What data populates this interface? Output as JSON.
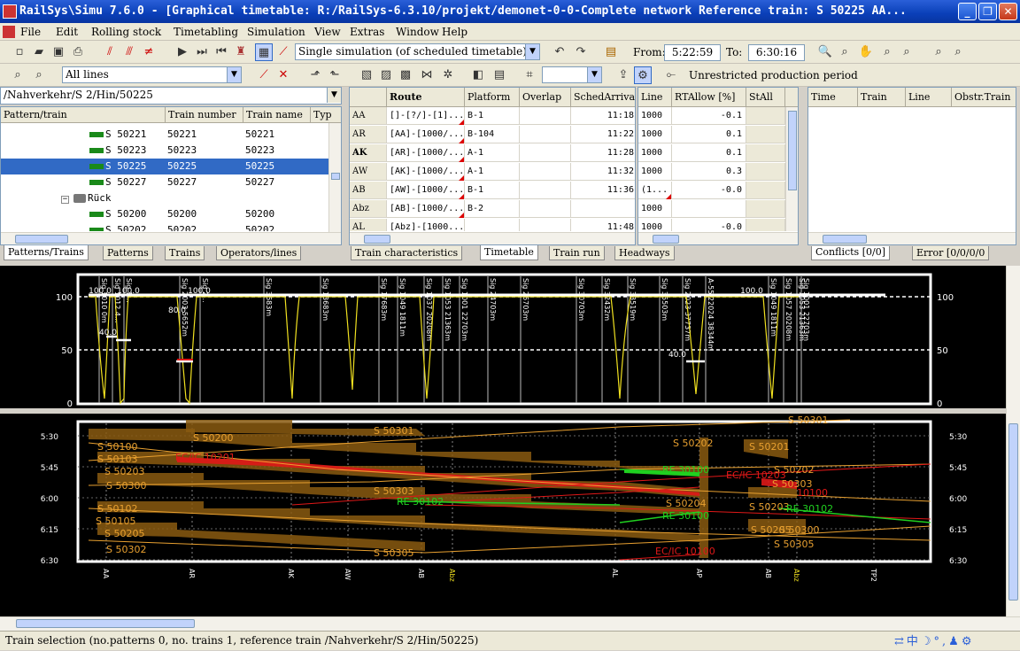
{
  "window": {
    "title": "RailSys\\Simu 7.6.0 - [Graphical timetable: R:/RailSys-6.3.10/projekt/demonet-0-0-Complete network    Reference train: S 50225    AA..."
  },
  "menu": [
    "File",
    "Edit",
    "Rolling stock",
    "Timetabling",
    "Simulation",
    "View",
    "Extras",
    "Window",
    "Help"
  ],
  "toolbar": {
    "simulation_mode": "Single simulation (of scheduled timetable)",
    "from_label": "From:",
    "from_value": "5:22:59",
    "to_label": "To:",
    "to_value": "6:30:16",
    "lines_filter": "All lines",
    "period_label": "Unrestricted production period"
  },
  "left_panel": {
    "path": "/Nahverkehr/S 2/Hin/50225",
    "columns": [
      "Pattern/train",
      "Train number",
      "Train name",
      "Typ"
    ],
    "rows": [
      {
        "name": "S 50221",
        "number": "50221",
        "tname": "50221"
      },
      {
        "name": "S 50223",
        "number": "50223",
        "tname": "50223"
      },
      {
        "name": "S 50225",
        "number": "50225",
        "tname": "50225",
        "selected": true
      },
      {
        "name": "S 50227",
        "number": "50227",
        "tname": "50227"
      },
      {
        "name": "Rück",
        "group": true
      },
      {
        "name": "S 50200",
        "number": "50200",
        "tname": "50200"
      },
      {
        "name": "S 50202",
        "number": "50202",
        "tname": "50202"
      }
    ],
    "tabs": [
      "Patterns/Trains",
      "Patterns",
      "Trains",
      "Operators/lines"
    ]
  },
  "middle_panel": {
    "columns": [
      "Route",
      "Platform",
      "Overlap",
      "SchedArrival"
    ],
    "rows": [
      {
        "stop": "AA",
        "route": "[]-[?/]-[1]...",
        "platform": "B-1",
        "overlap": "",
        "arrival": "11:18"
      },
      {
        "stop": "AR",
        "route": "[AA]-[1000/...",
        "platform": "B-104",
        "overlap": "",
        "arrival": "11:22"
      },
      {
        "stop": "AK",
        "route": "[AR]-[1000/...",
        "platform": "A-1",
        "overlap": "",
        "arrival": "11:28",
        "bold": true
      },
      {
        "stop": "AW",
        "route": "[AK]-[1000/...",
        "platform": "A-1",
        "overlap": "",
        "arrival": "11:32"
      },
      {
        "stop": "AB",
        "route": "[AW]-[1000/...",
        "platform": "B-1",
        "overlap": "",
        "arrival": "11:36"
      },
      {
        "stop": "Abz",
        "route": "[AB]-[1000/...",
        "platform": "B-2",
        "overlap": "",
        "arrival": ""
      },
      {
        "stop": "AL",
        "route": "[Abz]-[1000...",
        "platform": "",
        "overlap": "",
        "arrival": "11:48"
      }
    ],
    "tabs": [
      "Train characteristics",
      "Timetable",
      "Train run",
      "Headways"
    ]
  },
  "right_table": {
    "columns": [
      "Line",
      "RTAllow [%]",
      "StAll"
    ],
    "rows": [
      {
        "line": "1000",
        "rt": "-0.1"
      },
      {
        "line": "1000",
        "rt": "0.1"
      },
      {
        "line": "1000",
        "rt": "0.1"
      },
      {
        "line": "1000",
        "rt": "0.3"
      },
      {
        "line": "(1...",
        "rt": "-0.0"
      },
      {
        "line": "1000",
        "rt": ""
      },
      {
        "line": "1000",
        "rt": "-0.0"
      }
    ]
  },
  "conflicts_panel": {
    "columns": [
      "Time",
      "Train",
      "Line",
      "Obstr.Train"
    ],
    "tabs": [
      "Conflicts [0/0]",
      "Error [0/0/0/0"
    ]
  },
  "speed_profile": {
    "y_ticks": [
      "100",
      "50",
      "0"
    ],
    "speed_labels": [
      "100.0",
      "100.0",
      "100.0",
      "80.0",
      "40.0",
      "100.0",
      "40.0"
    ],
    "signals": [
      "Sig 1010 0m",
      "Sig 1012 4...",
      "Sig 1...",
      "Sig 2003 5652m",
      "Sig 2...",
      "Sig 3683m",
      "Sig 13683m",
      "Sig 17683m",
      "Sig 1049 1811m",
      "Sig 1037 20208m",
      "Sig 1053 21363m",
      "Sig 1001 22703m",
      "Sig 24703m",
      "Sig 26703m",
      "Sig 30703m",
      "Sig 32432m",
      "Sig 33519m",
      "Sig 35503m",
      "Sig 2023 37737m",
      "A-55 22024 38344m",
      "Sig 1049 1811m",
      "Sig 1057 20208m",
      "Sig 1053 21363m",
      "Sig 1001 22703m"
    ]
  },
  "timetable_graph": {
    "time_ticks": [
      "5:30",
      "5:45",
      "6:00",
      "6:15",
      "6:30"
    ],
    "stations": [
      "AA",
      "AR",
      "AK",
      "AW",
      "AB",
      "Abz",
      "AL",
      "AP",
      "AB",
      "Abz",
      "TP2"
    ],
    "train_labels": [
      {
        "text": "S 50100",
        "color": "orange"
      },
      {
        "text": "S 50103",
        "color": "orange"
      },
      {
        "text": "S 50203",
        "color": "orange"
      },
      {
        "text": "S 50300",
        "color": "orange"
      },
      {
        "text": "S 50102",
        "color": "orange"
      },
      {
        "text": "S 50105",
        "color": "orange"
      },
      {
        "text": "S 50205",
        "color": "orange"
      },
      {
        "text": "S 50302",
        "color": "orange"
      },
      {
        "text": "S 50200",
        "color": "orange"
      },
      {
        "text": "EC/IC 10201",
        "color": "red"
      },
      {
        "text": "S 50301",
        "color": "orange"
      },
      {
        "text": "S 50303",
        "color": "orange"
      },
      {
        "text": "RE 30102",
        "color": "green"
      },
      {
        "text": "S 50305",
        "color": "orange"
      },
      {
        "text": "S 50202",
        "color": "orange"
      },
      {
        "text": "RE 30100",
        "color": "green"
      },
      {
        "text": "S 50204",
        "color": "orange"
      },
      {
        "text": "RE 30100",
        "color": "green"
      },
      {
        "text": "EC/IC 10100",
        "color": "red"
      },
      {
        "text": "S 50201",
        "color": "orange"
      },
      {
        "text": "S 50202",
        "color": "orange"
      },
      {
        "text": "EC/IC 10203",
        "color": "red"
      },
      {
        "text": "S 50303",
        "color": "orange"
      },
      {
        "text": "10100",
        "color": "red"
      },
      {
        "text": "S 50203",
        "color": "orange"
      },
      {
        "text": "RE 30102",
        "color": "green"
      },
      {
        "text": "S 50205",
        "color": "orange"
      },
      {
        "text": "S 50300",
        "color": "orange"
      },
      {
        "text": "S 50305",
        "color": "orange"
      },
      {
        "text": "S 50301",
        "color": "orange"
      }
    ]
  },
  "status": {
    "text": "Train selection (no.patterns 0, no. trains 1, reference train /Nahverkehr/S 2/Hin/50225)"
  },
  "colors": {
    "titlebar": "#0a3fb8",
    "selection": "#316ac5",
    "s_bahn": "#e8a030",
    "ec_ic": "#e01818",
    "re": "#20d020",
    "block": "#8a5a10"
  }
}
